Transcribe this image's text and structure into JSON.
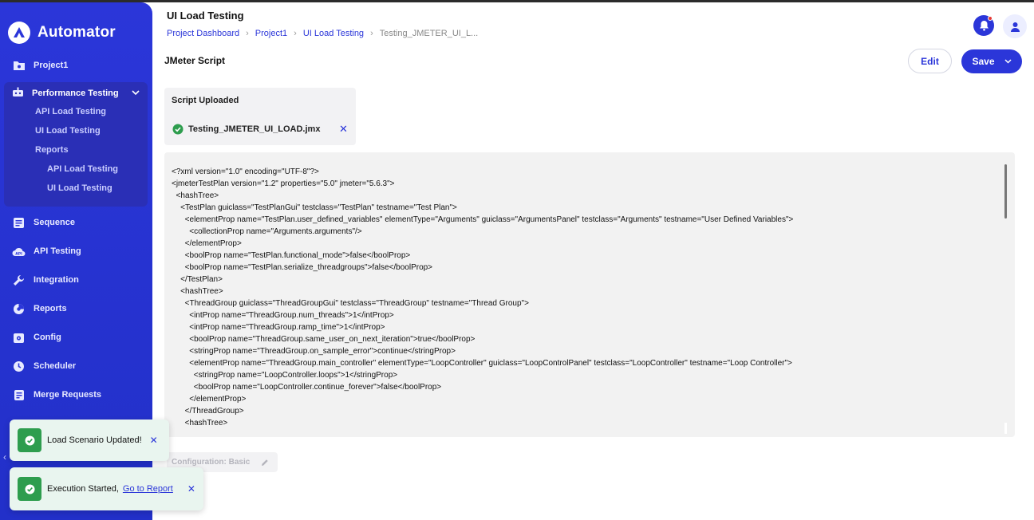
{
  "app": {
    "brand": "Automator"
  },
  "sidebar": {
    "project": "Project1",
    "group": {
      "label": "Performance Testing",
      "items": [
        "API Load Testing",
        "UI Load Testing",
        "Reports"
      ],
      "report_items": [
        "API Load Testing",
        "UI Load Testing"
      ]
    },
    "items": [
      "Sequence",
      "API Testing",
      "Integration",
      "Reports",
      "Config",
      "Scheduler",
      "Merge Requests"
    ]
  },
  "header": {
    "title": "UI Load Testing",
    "breadcrumb": [
      "Project Dashboard",
      "Project1",
      "UI Load Testing",
      "Testing_JMETER_UI_L..."
    ]
  },
  "section": {
    "title": "JMeter Script",
    "edit_label": "Edit",
    "save_label": "Save"
  },
  "upload": {
    "title": "Script Uploaded",
    "file_name": "Testing_JMETER_UI_LOAD.jmx"
  },
  "code_lines": [
    "<?xml version=\"1.0\" encoding=\"UTF-8\"?>",
    "<jmeterTestPlan version=\"1.2\" properties=\"5.0\" jmeter=\"5.6.3\">",
    "  <hashTree>",
    "    <TestPlan guiclass=\"TestPlanGui\" testclass=\"TestPlan\" testname=\"Test Plan\">",
    "      <elementProp name=\"TestPlan.user_defined_variables\" elementType=\"Arguments\" guiclass=\"ArgumentsPanel\" testclass=\"Arguments\" testname=\"User Defined Variables\">",
    "        <collectionProp name=\"Arguments.arguments\"/>",
    "      </elementProp>",
    "      <boolProp name=\"TestPlan.functional_mode\">false</boolProp>",
    "      <boolProp name=\"TestPlan.serialize_threadgroups\">false</boolProp>",
    "    </TestPlan>",
    "    <hashTree>",
    "      <ThreadGroup guiclass=\"ThreadGroupGui\" testclass=\"ThreadGroup\" testname=\"Thread Group\">",
    "        <intProp name=\"ThreadGroup.num_threads\">1</intProp>",
    "        <intProp name=\"ThreadGroup.ramp_time\">1</intProp>",
    "        <boolProp name=\"ThreadGroup.same_user_on_next_iteration\">true</boolProp>",
    "        <stringProp name=\"ThreadGroup.on_sample_error\">continue</stringProp>",
    "        <elementProp name=\"ThreadGroup.main_controller\" elementType=\"LoopController\" guiclass=\"LoopControlPanel\" testclass=\"LoopController\" testname=\"Loop Controller\">",
    "          <stringProp name=\"LoopController.loops\">1</stringProp>",
    "          <boolProp name=\"LoopController.continue_forever\">false</boolProp>",
    "        </elementProp>",
    "      </ThreadGroup>",
    "      <hashTree>"
  ],
  "config_chip": "Configuration: Basic",
  "toasts": {
    "scenario": {
      "message": "Load Scenario Updated!"
    },
    "execution": {
      "message": "Execution Started,",
      "link": "Go to Report"
    }
  },
  "colors": {
    "accent": "#2b36d9",
    "success": "#2e9d4e",
    "notification": "#e53935"
  }
}
